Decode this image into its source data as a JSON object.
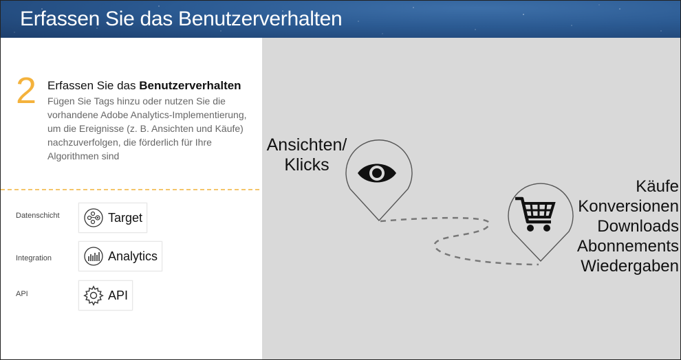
{
  "header": {
    "title": "Erfassen Sie das Benutzerverhalten"
  },
  "step": {
    "number": "2",
    "title_plain": "Erfassen Sie das ",
    "title_bold": "Benutzerverhalten",
    "description": "Fügen Sie Tags hinzu oder nutzen Sie die vorhandene Adobe Analytics-Implementierung, um die Ereignisse (z. B. Ansichten und Käufe) nachzuverfolgen, die förderlich für Ihre Algorithmen sind"
  },
  "sources": [
    {
      "label": "Datenschicht",
      "chip": "Target",
      "icon": "target-icon"
    },
    {
      "label": "Integration",
      "chip": "Analytics",
      "icon": "analytics-icon"
    },
    {
      "label": "API",
      "chip": "API",
      "icon": "gear-icon"
    }
  ],
  "diagram": {
    "views_line1": "Ansichten/",
    "views_line2": "Klicks",
    "outcomes": [
      "Käufe",
      "Konversionen",
      "Downloads",
      "Abonnements",
      "Wiedergaben"
    ],
    "pin1_icon": "eye-icon",
    "pin2_icon": "shopping-cart-icon"
  },
  "colors": {
    "accent": "#f4b23c",
    "header": "#2b5a92",
    "panel": "#d9d9d9"
  }
}
